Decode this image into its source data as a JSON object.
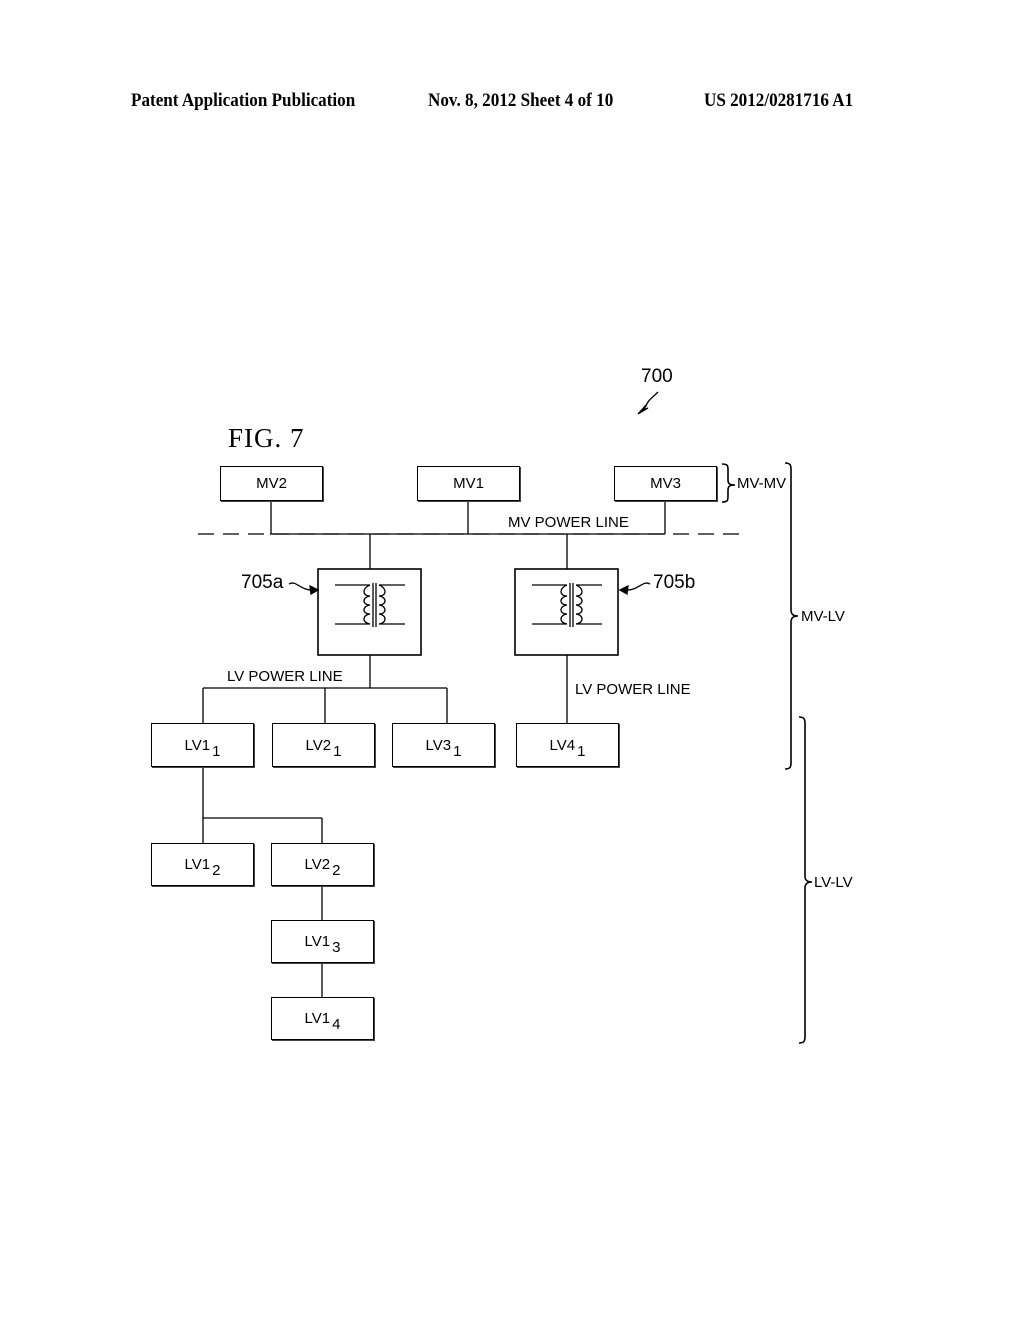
{
  "header": {
    "publication": "Patent Application Publication",
    "date_sheet": "Nov. 8, 2012   Sheet 4 of 10",
    "patent_number": "US 2012/0281716 A1"
  },
  "figure": {
    "title": "FIG. 7",
    "reference": "700",
    "transformers": [
      {
        "id": "705a",
        "label": "705a"
      },
      {
        "id": "705b",
        "label": "705b"
      }
    ],
    "line_labels": {
      "mv_power_line": "MV POWER LINE",
      "lv_power_line_a": "LV POWER LINE",
      "lv_power_line_b": "LV POWER LINE"
    },
    "mv_nodes": [
      {
        "name": "MV2"
      },
      {
        "name": "MV1"
      },
      {
        "name": "MV3"
      }
    ],
    "lv_nodes": [
      {
        "base": "LV1",
        "sub": "1"
      },
      {
        "base": "LV2",
        "sub": "1"
      },
      {
        "base": "LV3",
        "sub": "1"
      },
      {
        "base": "LV4",
        "sub": "1"
      },
      {
        "base": "LV1",
        "sub": "2"
      },
      {
        "base": "LV2",
        "sub": "2"
      },
      {
        "base": "LV1",
        "sub": "3"
      },
      {
        "base": "LV1",
        "sub": "4"
      }
    ],
    "brackets": {
      "mv_mv": "MV-MV",
      "mv_lv": "MV-LV",
      "lv_lv": "LV-LV"
    }
  }
}
